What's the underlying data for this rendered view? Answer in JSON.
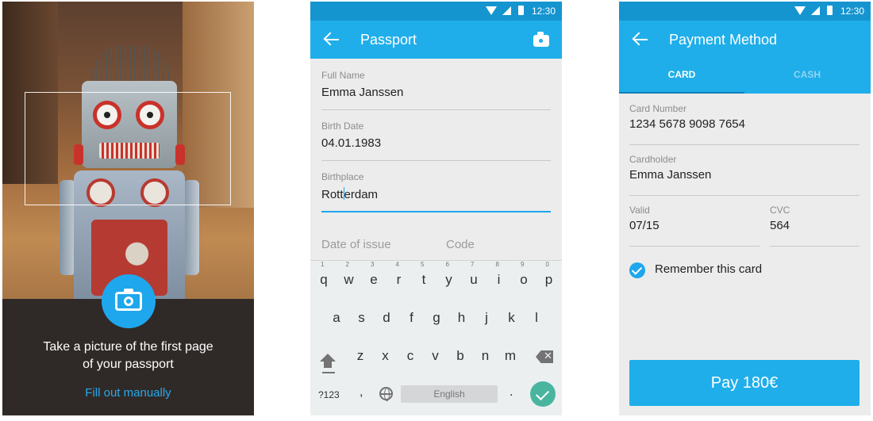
{
  "camera_screen": {
    "instruction_line1": "Take a picture of the first page",
    "instruction_line2": "of your passport",
    "manual_link": "Fill out manually",
    "shutter_icon": "camera-icon"
  },
  "status_bar": {
    "time": "12:30"
  },
  "passport_screen": {
    "title": "Passport",
    "fields": [
      {
        "label": "Full Name",
        "value": "Emma Janssen"
      },
      {
        "label": "Birth Date",
        "value": "04.01.1983"
      }
    ],
    "birthplace": {
      "label": "Birthplace",
      "before_cursor": "Rott",
      "after_cursor": "erdam"
    },
    "placeholders": {
      "date_of_issue": "Date of issue",
      "code": "Code"
    },
    "keyboard": {
      "row1": [
        "q",
        "w",
        "e",
        "r",
        "t",
        "y",
        "u",
        "i",
        "o",
        "p"
      ],
      "row1_hints": [
        "1",
        "2",
        "3",
        "4",
        "5",
        "6",
        "7",
        "8",
        "9",
        "0"
      ],
      "row2": [
        "a",
        "s",
        "d",
        "f",
        "g",
        "h",
        "j",
        "k",
        "l"
      ],
      "row3": [
        "z",
        "x",
        "c",
        "v",
        "b",
        "n",
        "m"
      ],
      "num_key": "?123",
      "comma_key": ",",
      "space_label": "English",
      "period_key": "."
    }
  },
  "payment_screen": {
    "title": "Payment Method",
    "tabs": {
      "card": "CARD",
      "cash": "CASH"
    },
    "card_number": {
      "label": "Card Number",
      "value": "1234 5678 9098 7654"
    },
    "cardholder": {
      "label": "Cardholder",
      "value": "Emma Janssen"
    },
    "valid": {
      "label": "Valid",
      "value": "07/15"
    },
    "cvc": {
      "label": "CVC",
      "value": "564"
    },
    "remember": "Remember this card",
    "pay_button": "Pay 180€"
  },
  "colors": {
    "accent": "#1faeea",
    "status_bar": "#1595d0",
    "enter_key": "#4ab59f"
  }
}
